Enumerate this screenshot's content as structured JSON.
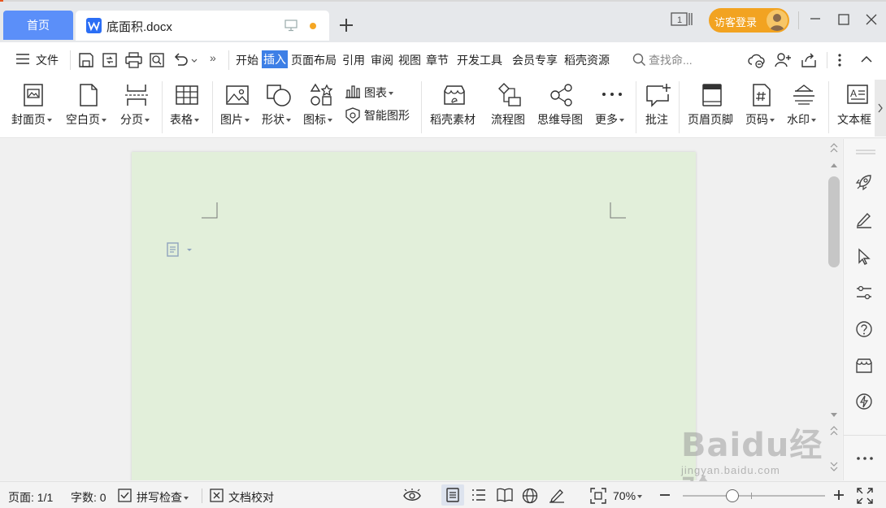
{
  "tabs": {
    "home": "首页",
    "document": "底面积.docx",
    "new": "+"
  },
  "window": {
    "login": "访客登录",
    "page_indicator": "1"
  },
  "menu": {
    "file": "文件",
    "tabs": [
      "开始",
      "插入",
      "页面布局",
      "引用",
      "审阅",
      "视图",
      "章节",
      "开发工具",
      "会员专享",
      "稻壳资源"
    ],
    "active_tab": "插入",
    "more": "»",
    "search_placeholder": "查找命..."
  },
  "ribbon": {
    "cover_page": "封面页",
    "blank_page": "空白页",
    "page_break": "分页",
    "table": "表格",
    "picture": "图片",
    "shape": "形状",
    "icon": "图标",
    "chart": "图表",
    "smart_graphic": "智能图形",
    "docer_material": "稻壳素材",
    "flowchart": "流程图",
    "mind_map": "思维导图",
    "more": "更多",
    "comment": "批注",
    "header_footer": "页眉页脚",
    "page_number": "页码",
    "watermark": "水印",
    "textbox": "文本框"
  },
  "status": {
    "page": "页面: 1/1",
    "word_count": "字数: 0",
    "spell_check": "拼写检查",
    "proofread": "文档校对",
    "zoom": "70%"
  },
  "watermark": {
    "brand": "Baidu经验",
    "url": "jingyan.baidu.com"
  },
  "colors": {
    "accent": "#5b8ff9",
    "active_menu": "#3d7fe6",
    "page_background": "#e2efda",
    "login_button": "#f2a321",
    "unsaved_dot": "#f5a623"
  },
  "zoom_level": 0.35
}
